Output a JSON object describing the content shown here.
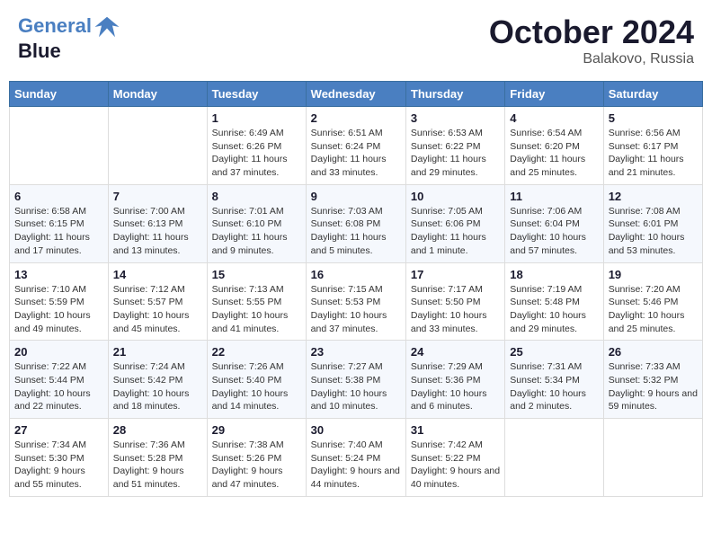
{
  "header": {
    "logo_line1": "General",
    "logo_line2": "Blue",
    "month_title": "October 2024",
    "location": "Balakovo, Russia"
  },
  "days_of_week": [
    "Sunday",
    "Monday",
    "Tuesday",
    "Wednesday",
    "Thursday",
    "Friday",
    "Saturday"
  ],
  "weeks": [
    [
      {
        "day": "",
        "info": ""
      },
      {
        "day": "",
        "info": ""
      },
      {
        "day": "1",
        "info": "Sunrise: 6:49 AM\nSunset: 6:26 PM\nDaylight: 11 hours and 37 minutes."
      },
      {
        "day": "2",
        "info": "Sunrise: 6:51 AM\nSunset: 6:24 PM\nDaylight: 11 hours and 33 minutes."
      },
      {
        "day": "3",
        "info": "Sunrise: 6:53 AM\nSunset: 6:22 PM\nDaylight: 11 hours and 29 minutes."
      },
      {
        "day": "4",
        "info": "Sunrise: 6:54 AM\nSunset: 6:20 PM\nDaylight: 11 hours and 25 minutes."
      },
      {
        "day": "5",
        "info": "Sunrise: 6:56 AM\nSunset: 6:17 PM\nDaylight: 11 hours and 21 minutes."
      }
    ],
    [
      {
        "day": "6",
        "info": "Sunrise: 6:58 AM\nSunset: 6:15 PM\nDaylight: 11 hours and 17 minutes."
      },
      {
        "day": "7",
        "info": "Sunrise: 7:00 AM\nSunset: 6:13 PM\nDaylight: 11 hours and 13 minutes."
      },
      {
        "day": "8",
        "info": "Sunrise: 7:01 AM\nSunset: 6:10 PM\nDaylight: 11 hours and 9 minutes."
      },
      {
        "day": "9",
        "info": "Sunrise: 7:03 AM\nSunset: 6:08 PM\nDaylight: 11 hours and 5 minutes."
      },
      {
        "day": "10",
        "info": "Sunrise: 7:05 AM\nSunset: 6:06 PM\nDaylight: 11 hours and 1 minute."
      },
      {
        "day": "11",
        "info": "Sunrise: 7:06 AM\nSunset: 6:04 PM\nDaylight: 10 hours and 57 minutes."
      },
      {
        "day": "12",
        "info": "Sunrise: 7:08 AM\nSunset: 6:01 PM\nDaylight: 10 hours and 53 minutes."
      }
    ],
    [
      {
        "day": "13",
        "info": "Sunrise: 7:10 AM\nSunset: 5:59 PM\nDaylight: 10 hours and 49 minutes."
      },
      {
        "day": "14",
        "info": "Sunrise: 7:12 AM\nSunset: 5:57 PM\nDaylight: 10 hours and 45 minutes."
      },
      {
        "day": "15",
        "info": "Sunrise: 7:13 AM\nSunset: 5:55 PM\nDaylight: 10 hours and 41 minutes."
      },
      {
        "day": "16",
        "info": "Sunrise: 7:15 AM\nSunset: 5:53 PM\nDaylight: 10 hours and 37 minutes."
      },
      {
        "day": "17",
        "info": "Sunrise: 7:17 AM\nSunset: 5:50 PM\nDaylight: 10 hours and 33 minutes."
      },
      {
        "day": "18",
        "info": "Sunrise: 7:19 AM\nSunset: 5:48 PM\nDaylight: 10 hours and 29 minutes."
      },
      {
        "day": "19",
        "info": "Sunrise: 7:20 AM\nSunset: 5:46 PM\nDaylight: 10 hours and 25 minutes."
      }
    ],
    [
      {
        "day": "20",
        "info": "Sunrise: 7:22 AM\nSunset: 5:44 PM\nDaylight: 10 hours and 22 minutes."
      },
      {
        "day": "21",
        "info": "Sunrise: 7:24 AM\nSunset: 5:42 PM\nDaylight: 10 hours and 18 minutes."
      },
      {
        "day": "22",
        "info": "Sunrise: 7:26 AM\nSunset: 5:40 PM\nDaylight: 10 hours and 14 minutes."
      },
      {
        "day": "23",
        "info": "Sunrise: 7:27 AM\nSunset: 5:38 PM\nDaylight: 10 hours and 10 minutes."
      },
      {
        "day": "24",
        "info": "Sunrise: 7:29 AM\nSunset: 5:36 PM\nDaylight: 10 hours and 6 minutes."
      },
      {
        "day": "25",
        "info": "Sunrise: 7:31 AM\nSunset: 5:34 PM\nDaylight: 10 hours and 2 minutes."
      },
      {
        "day": "26",
        "info": "Sunrise: 7:33 AM\nSunset: 5:32 PM\nDaylight: 9 hours and 59 minutes."
      }
    ],
    [
      {
        "day": "27",
        "info": "Sunrise: 7:34 AM\nSunset: 5:30 PM\nDaylight: 9 hours and 55 minutes."
      },
      {
        "day": "28",
        "info": "Sunrise: 7:36 AM\nSunset: 5:28 PM\nDaylight: 9 hours and 51 minutes."
      },
      {
        "day": "29",
        "info": "Sunrise: 7:38 AM\nSunset: 5:26 PM\nDaylight: 9 hours and 47 minutes."
      },
      {
        "day": "30",
        "info": "Sunrise: 7:40 AM\nSunset: 5:24 PM\nDaylight: 9 hours and 44 minutes."
      },
      {
        "day": "31",
        "info": "Sunrise: 7:42 AM\nSunset: 5:22 PM\nDaylight: 9 hours and 40 minutes."
      },
      {
        "day": "",
        "info": ""
      },
      {
        "day": "",
        "info": ""
      }
    ]
  ]
}
